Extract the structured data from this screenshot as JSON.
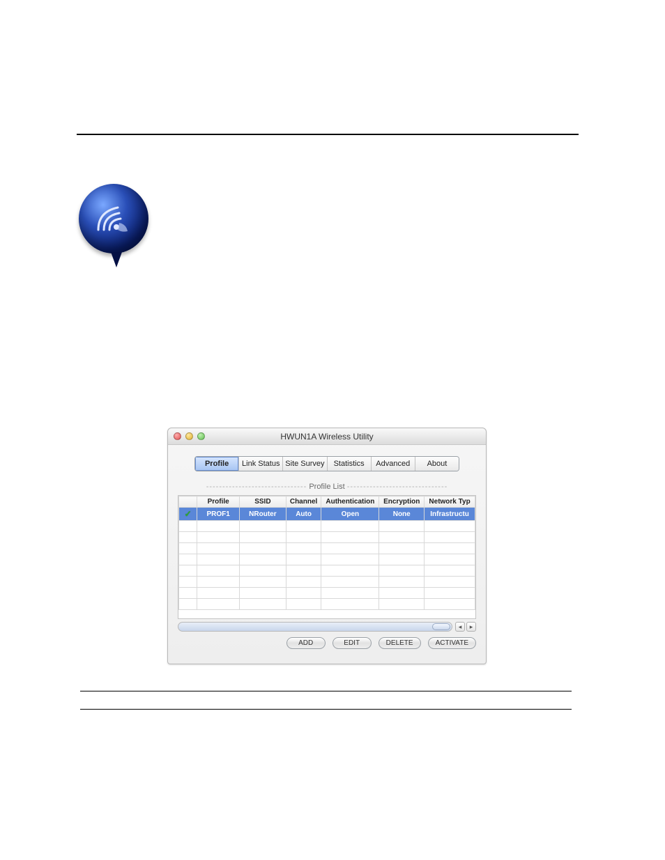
{
  "window": {
    "title": "HWUN1A Wireless Utility"
  },
  "tabs": {
    "profile": "Profile",
    "link_status": "Link Status",
    "site_survey": "Site Survey",
    "statistics": "Statistics",
    "advanced": "Advanced",
    "about": "About"
  },
  "panel": {
    "title": "Profile List",
    "dashes": "-------------------------------"
  },
  "columns": {
    "status": "",
    "profile": "Profile",
    "ssid": "SSID",
    "channel": "Channel",
    "authentication": "Authentication",
    "encryption": "Encryption",
    "network_type": "Network Typ"
  },
  "rows": [
    {
      "active": true,
      "profile": "PROF1",
      "ssid": "NRouter",
      "channel": "Auto",
      "authentication": "Open",
      "encryption": "None",
      "network_type": "Infrastructu"
    }
  ],
  "buttons": {
    "add": "ADD",
    "edit": "EDIT",
    "delete": "DELETE",
    "activate": "ACTIVATE"
  }
}
